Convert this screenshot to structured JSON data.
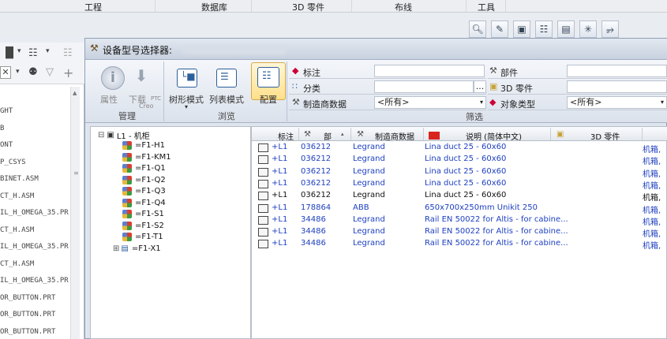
{
  "menubar": {
    "items": [
      "工程",
      "数据库",
      "3D 零件",
      "布线",
      "工具"
    ]
  },
  "top_toolbar": {
    "icons": [
      "zoom-icon",
      "edit-icon",
      "box-icon",
      "document-icon",
      "save-icon",
      "sparkle-icon",
      "connect-icon"
    ]
  },
  "left_panel": {
    "items": [
      "GHT",
      "B",
      "ONT",
      "P_CSYS",
      "BINET.ASM",
      "CT_H.ASM",
      "IL_H_OMEGA_35.PR",
      "CT_H.ASM",
      "IL_H_OMEGA_35.PR",
      "CT_H.ASM",
      "IL_H_OMEGA_35.PR",
      "OR_BUTTON.PRT",
      "OR_BUTTON.PRT",
      "OR_BUTTON.PRT"
    ]
  },
  "dialog": {
    "title": "设备型号选择器:",
    "ribbon": {
      "manage": {
        "props_label": "属性",
        "download_label": "下载",
        "download_sub_top": "PTC",
        "download_sub_bottom": "Creo",
        "group_label": "管理"
      },
      "browse": {
        "tree_label": "树形模式",
        "list_label": "列表模式",
        "config_label": "配置",
        "group_label": "浏览"
      },
      "filter": {
        "group_label": "筛选",
        "rows": [
          {
            "label": "标注",
            "value": ""
          },
          {
            "label": "分类",
            "value": ""
          },
          {
            "label": "制造商数据",
            "value": "<所有>"
          }
        ],
        "right_rows": [
          {
            "label": "部件",
            "value": ""
          },
          {
            "label": "3D 零件",
            "value": ""
          },
          {
            "label": "对象类型",
            "value": "<所有>"
          }
        ],
        "ellipsis": "..."
      }
    },
    "tree": {
      "root": "L1 - 机柜",
      "children": [
        "=F1-H1",
        "=F1-KM1",
        "=F1-Q1",
        "=F1-Q2",
        "=F1-Q3",
        "=F1-Q4",
        "=F1-S1",
        "=F1-S2",
        "=F1-T1",
        "=F1-X1"
      ]
    },
    "table": {
      "headers": [
        "标注",
        "部",
        "制造商数据",
        "说明 (简体中文)",
        "3D 零件"
      ],
      "rows": [
        {
          "tag": "+L1",
          "part": "036212",
          "mfr": "Legrand",
          "desc": "Lina duct 25 - 60x60",
          "cat": "机箱,",
          "color": "blue"
        },
        {
          "tag": "+L1",
          "part": "036212",
          "mfr": "Legrand",
          "desc": "Lina duct 25 - 60x60",
          "cat": "机箱,",
          "color": "blue"
        },
        {
          "tag": "+L1",
          "part": "036212",
          "mfr": "Legrand",
          "desc": "Lina duct 25 - 60x60",
          "cat": "机箱,",
          "color": "blue"
        },
        {
          "tag": "+L1",
          "part": "036212",
          "mfr": "Legrand",
          "desc": "Lina duct 25 - 60x60",
          "cat": "机箱,",
          "color": "blue"
        },
        {
          "tag": "+L1",
          "part": "036212",
          "mfr": "Legrand",
          "desc": "Lina duct 25 - 60x60",
          "cat": "机箱,",
          "color": "black"
        },
        {
          "tag": "+L1",
          "part": "178864",
          "mfr": "ABB",
          "desc": "650x700x250mm Unikit 250",
          "cat": "机箱,",
          "color": "blue"
        },
        {
          "tag": "+L1",
          "part": "34486",
          "mfr": "Legrand",
          "desc": "Rail EN 50022 for Altis - for cabine...",
          "cat": "机箱,",
          "color": "blue"
        },
        {
          "tag": "+L1",
          "part": "34486",
          "mfr": "Legrand",
          "desc": "Rail EN 50022 for Altis - for cabine...",
          "cat": "机箱,",
          "color": "blue"
        },
        {
          "tag": "+L1",
          "part": "34486",
          "mfr": "Legrand",
          "desc": "Rail EN 50022 for Altis - for cabine...",
          "cat": "机箱,",
          "color": "blue"
        }
      ]
    }
  },
  "colors": {
    "row_blue": "#1d3fc0",
    "dialog_bg": "#dfe5ee"
  }
}
